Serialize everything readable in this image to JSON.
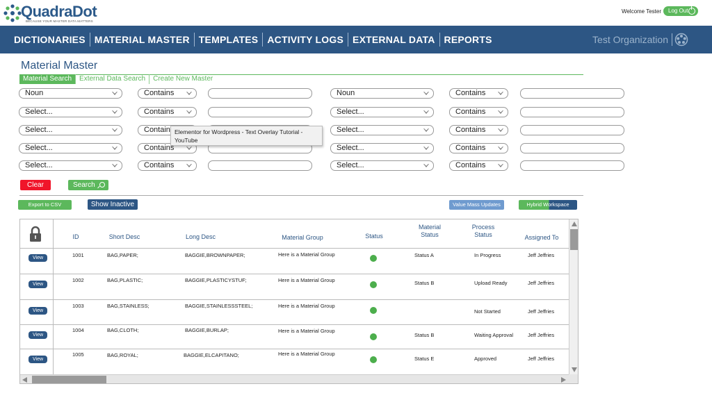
{
  "header": {
    "logo_text": "QuadraDot",
    "logo_tagline": "BECAUSE YOUR MASTER DATA MATTERS",
    "welcome": "Welcome Tester",
    "logout_label": "Log Out"
  },
  "nav": {
    "items": [
      "DICTIONARIES",
      "MATERIAL MASTER",
      "TEMPLATES",
      "ACTIVITY LOGS",
      "EXTERNAL DATA",
      "REPORTS"
    ],
    "organization": "Test Organization"
  },
  "page": {
    "title": "Material Master",
    "tabs": [
      "Material Search",
      "External Data Search",
      "Create New Master"
    ],
    "active_tab": "Material Search"
  },
  "criteria": {
    "left": [
      {
        "field": "Noun",
        "operator": "Contains",
        "value": ""
      },
      {
        "field": "Select...",
        "operator": "Contains",
        "value": ""
      },
      {
        "field": "Select...",
        "operator": "Contains",
        "value": ""
      },
      {
        "field": "Select...",
        "operator": "Contains",
        "value": ""
      },
      {
        "field": "Select...",
        "operator": "Contains",
        "value": ""
      }
    ],
    "right": [
      {
        "field": "Noun",
        "operator": "Contains",
        "value": ""
      },
      {
        "field": "Select...",
        "operator": "Contains",
        "value": ""
      },
      {
        "field": "Select...",
        "operator": "Contains",
        "value": ""
      },
      {
        "field": "Select...",
        "operator": "Contains",
        "value": ""
      },
      {
        "field": "Select...",
        "operator": "Contains",
        "value": ""
      }
    ]
  },
  "actions": {
    "clear": "Clear",
    "search": "Search",
    "export": "Export to CSV",
    "show_inactive": "Show Inactive",
    "value_mass_updates": "Value Mass Updates",
    "hybrid_workspace": "Hybrid Workspace"
  },
  "tooltip": {
    "text": "Elementor for Wordpress - Text Overlay Tutorial - YouTube"
  },
  "table": {
    "columns": {
      "id": "ID",
      "short_desc": "Short Desc",
      "long_desc": "Long Desc",
      "material_group": "Material Group",
      "status": "Status",
      "material_status": "Material Status",
      "process_status": "Process Status",
      "assigned_to": "Assigned To"
    },
    "view_label": "View",
    "rows": [
      {
        "id": "1001",
        "short": "BAG,PAPER;",
        "long": "BAGGIE,BROWNPAPER;",
        "group": "Here is a Material Group",
        "material_status": "Status A",
        "process_status": "In Progress",
        "assigned": "Jeff Jeffries"
      },
      {
        "id": "1002",
        "short": "BAG,PLASTIC;",
        "long": "BAGGIE,PLASTICYSTUF;",
        "group": "Here is a Material Group",
        "material_status": "Status B",
        "process_status": "Upload Ready",
        "assigned": "Jeff Jeffries"
      },
      {
        "id": "1003",
        "short": "BAG,STAINLESS;",
        "long": "BAGGIE,STAINLESSSTEEL;",
        "group": "Here is a Material Group",
        "material_status": "",
        "process_status": "Not Started",
        "assigned": "Jeff Jeffries"
      },
      {
        "id": "1004",
        "short": "BAG,CLOTH;",
        "long": "BAGGIE,BURLAP;",
        "group": "Here is a Material Group",
        "material_status": "Status B",
        "process_status": "Waiting Approval",
        "assigned": "Jeff Jeffries"
      },
      {
        "id": "1005",
        "short": "BAG,ROYAL;",
        "long": "BAGGIE,ELCAPITANO;",
        "group": "Here is a Material Group",
        "material_status": "Status E",
        "process_status": "Approved",
        "assigned": "Jeff Jeffries"
      }
    ]
  },
  "colors": {
    "brand_blue": "#2d5684",
    "accent_green": "#5cb85c",
    "danger_red": "#f0152a",
    "status_active": "#4cae4c"
  }
}
